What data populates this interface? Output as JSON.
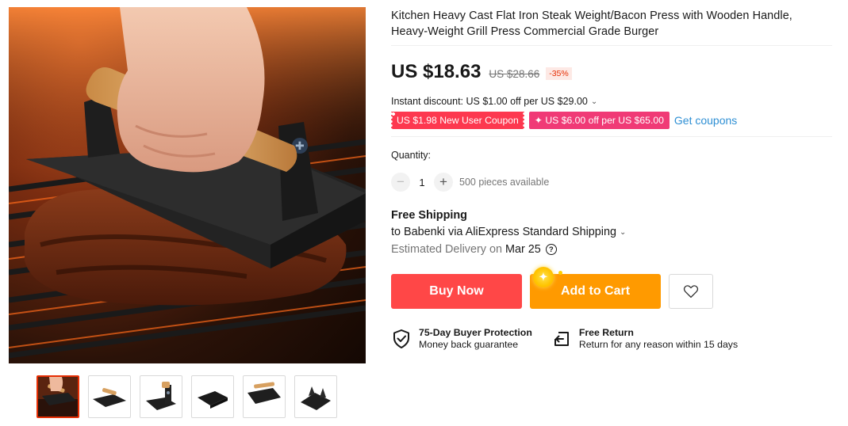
{
  "product": {
    "title": "Kitchen Heavy Cast Flat Iron Steak Weight/Bacon Press with Wooden Handle, Heavy-Weight Grill Press Commercial Grade Burger",
    "gallery": {
      "thumbnail_count": 6,
      "active_thumbnail": 0
    }
  },
  "price": {
    "current": "US $18.63",
    "original": "US $28.66",
    "discount": "-35%"
  },
  "promotions": {
    "instant_discount": "Instant discount: US $1.00 off per US $29.00",
    "coupon_new_user": "US $1.98 New User Coupon",
    "coupon_store": "✦ US $6.00 off per US $65.00",
    "get_coupons": "Get coupons"
  },
  "quantity": {
    "label": "Quantity:",
    "value": "1",
    "minus": "−",
    "plus": "+",
    "available": "500 pieces available"
  },
  "shipping": {
    "title": "Free Shipping",
    "destination": "to Babenki via AliExpress Standard Shipping",
    "delivery_label": "Estimated Delivery on",
    "delivery_date": "Mar 25",
    "help_glyph": "?"
  },
  "actions": {
    "buy_now": "Buy Now",
    "add_to_cart": "Add to Cart",
    "wishlist_icon": "heart-icon"
  },
  "guarantees": [
    {
      "icon": "shield-check-icon",
      "title": "75-Day Buyer Protection",
      "subtitle": "Money back guarantee"
    },
    {
      "icon": "return-arrow-icon",
      "title": "Free Return",
      "subtitle": "Return for any reason within 15 days"
    }
  ],
  "colors": {
    "buy_now": "#ff4747",
    "add_to_cart": "#ff9a00",
    "coupon_red": "#fd384f",
    "coupon_pink": "#f03a76",
    "link_blue": "#2e8fd4",
    "discount_text": "#e62e04"
  }
}
